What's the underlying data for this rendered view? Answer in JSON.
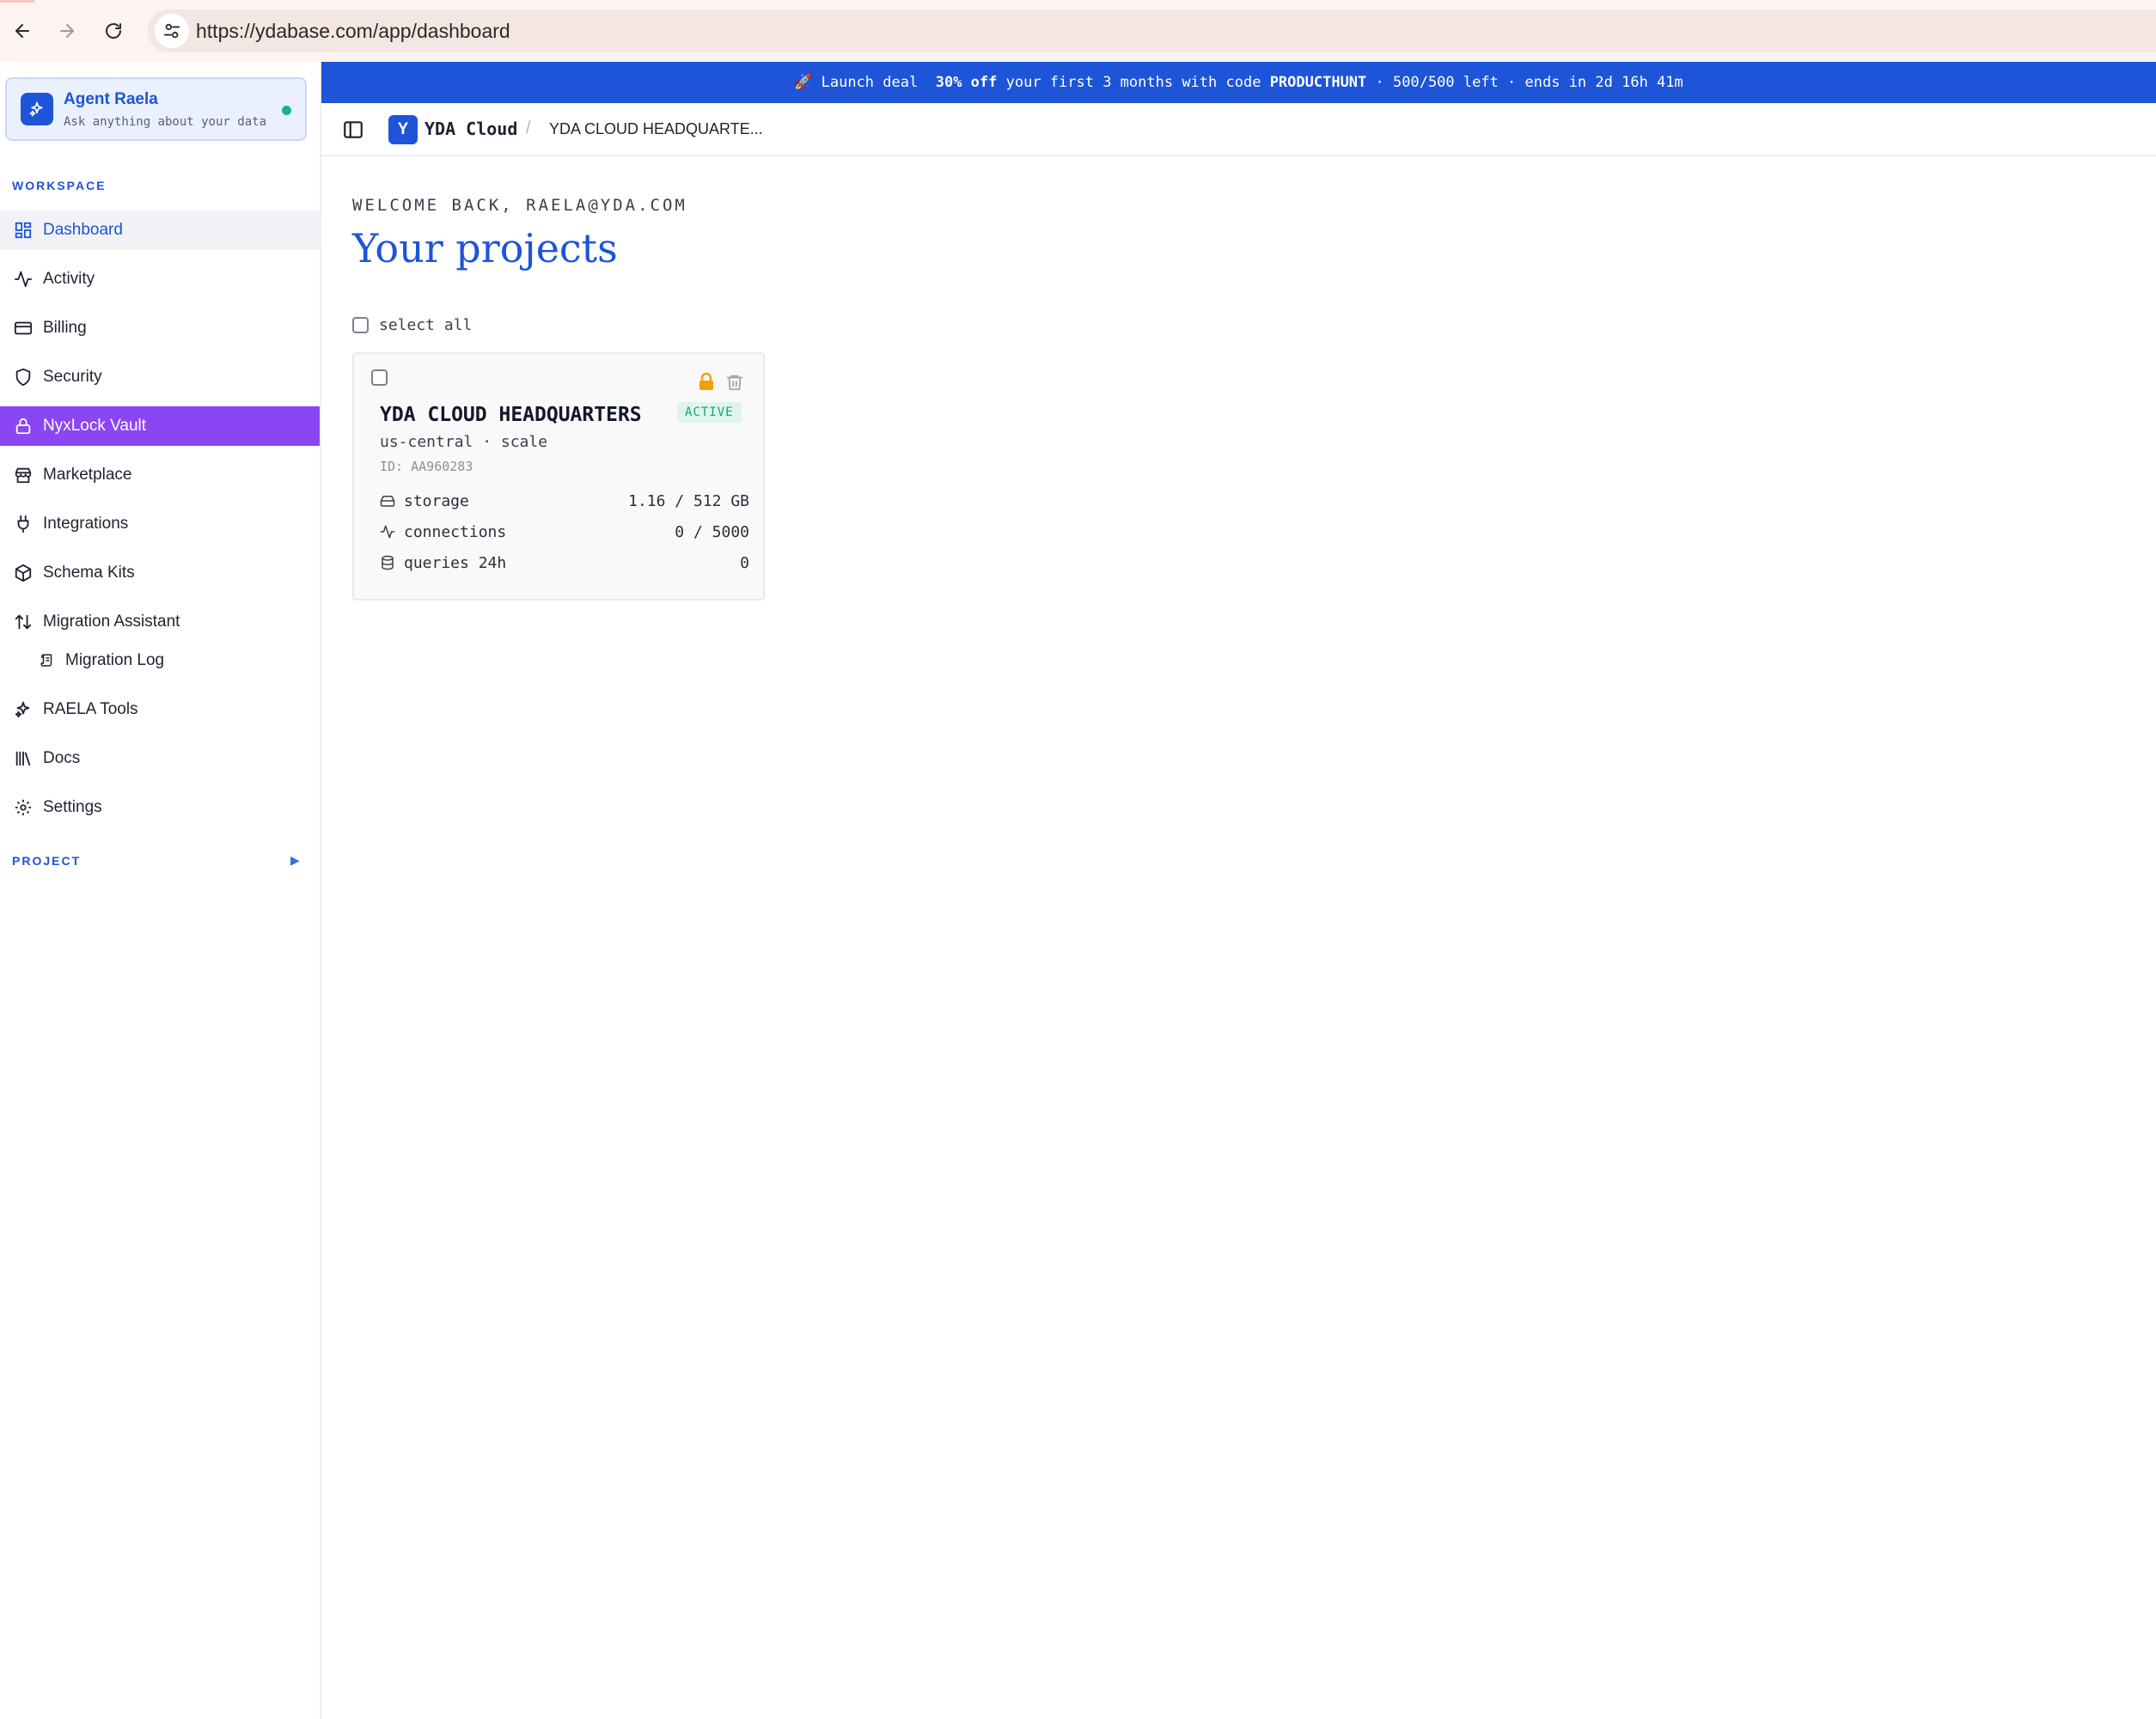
{
  "browser": {
    "url": "https://ydabase.com/app/dashboard"
  },
  "agent": {
    "title": "Agent Raela",
    "subtitle": "Ask anything about your data"
  },
  "sidebar": {
    "workspace_label": "WORKSPACE",
    "project_label": "PROJECT",
    "items": [
      {
        "label": "Dashboard",
        "icon": "dashboard-icon"
      },
      {
        "label": "Activity",
        "icon": "activity-icon"
      },
      {
        "label": "Billing",
        "icon": "credit-card-icon"
      },
      {
        "label": "Security",
        "icon": "shield-icon"
      },
      {
        "label": "NyxLock Vault",
        "icon": "lock-icon"
      },
      {
        "label": "Marketplace",
        "icon": "store-icon"
      },
      {
        "label": "Integrations",
        "icon": "plug-icon"
      },
      {
        "label": "Schema Kits",
        "icon": "package-icon"
      },
      {
        "label": "Migration Assistant",
        "icon": "arrows-up-down-icon"
      },
      {
        "label": "Migration Log",
        "icon": "scroll-icon"
      },
      {
        "label": "RAELA Tools",
        "icon": "sparkles-icon"
      },
      {
        "label": "Docs",
        "icon": "library-icon"
      },
      {
        "label": "Settings",
        "icon": "gear-icon"
      }
    ]
  },
  "banner": {
    "prefix": "🚀 Launch deal",
    "highlight": "30% off",
    "middle": "your first 3 months with code",
    "code": "PRODUCTHUNT",
    "suffix": "· 500/500 left · ends in 2d 16h 41m"
  },
  "header": {
    "brand_letter": "Y",
    "brand_name": "YDA Cloud",
    "separator": "/",
    "breadcrumb": "YDA CLOUD HEADQUARTE..."
  },
  "main": {
    "welcome": "WELCOME BACK, RAELA@YDA.COM",
    "title": "Your projects",
    "select_all": "select all"
  },
  "project": {
    "name": "YDA CLOUD HEADQUARTERS",
    "status": "ACTIVE",
    "subtitle": "us-central · scale",
    "id": "ID: AA960283",
    "metrics": [
      {
        "label": "storage",
        "value": "1.16 / 512 GB",
        "icon": "hard-drive-icon"
      },
      {
        "label": "connections",
        "value": "0 / 5000",
        "icon": "activity-icon"
      },
      {
        "label": "queries 24h",
        "value": "0",
        "icon": "database-icon"
      }
    ]
  },
  "colors": {
    "accent": "#1d54d8",
    "vault": "#8b45f3",
    "status": "#10a37a",
    "lock": "#f59e0b"
  }
}
